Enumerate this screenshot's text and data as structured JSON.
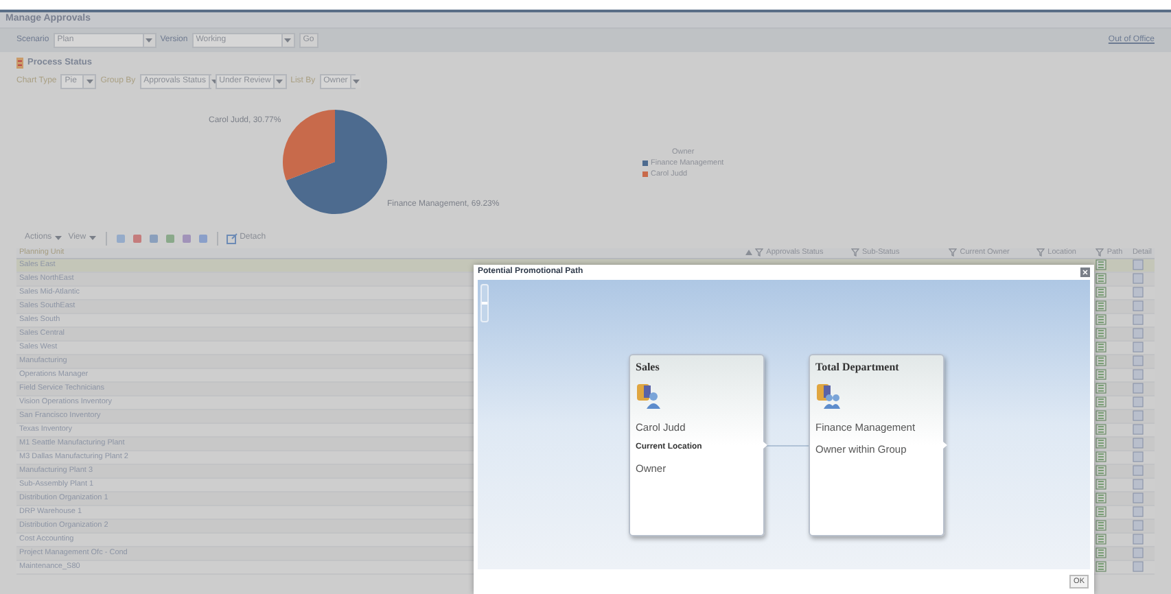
{
  "window": {
    "title": "Manage Approvals",
    "link": "Out of Office"
  },
  "filters": [
    {
      "label": "Scenario",
      "value": "Plan"
    },
    {
      "label": "Version",
      "value": "Working"
    }
  ],
  "go_button": "Go",
  "process_status": {
    "title": "Process Status",
    "controls": [
      {
        "label": "Chart Type",
        "value": "Pie"
      },
      {
        "label": "Group By",
        "value": "Approvals Status"
      },
      {
        "value": "Under Review"
      },
      {
        "label": "List By",
        "value": "Owner"
      }
    ],
    "chart_data": {
      "type": "pie",
      "categories": [
        "Finance Management",
        "Carol Judd"
      ],
      "series": [
        {
          "name": "Owner",
          "values": [
            69.23,
            30.77
          ]
        }
      ],
      "value_labels": [
        "Finance Management, 69.23%",
        "Carol Judd, 30.77%"
      ]
    },
    "legend": {
      "items": [
        {
          "color": "#4d6b8f"
        },
        {
          "color": "#c86a4b"
        }
      ]
    }
  },
  "toolbar": {
    "menus": [
      "Actions",
      "View"
    ],
    "detach": "Detach"
  },
  "table": {
    "columns": [
      {
        "label": "Planning Unit",
        "filter": false,
        "sorted": false
      },
      {
        "label": "Approvals Status",
        "filter": true,
        "sorted": true
      },
      {
        "label": "Sub-Status",
        "filter": true,
        "sorted": false
      },
      {
        "label": "Current Owner",
        "filter": true,
        "sorted": false
      },
      {
        "label": "Location",
        "filter": true,
        "sorted": false
      },
      {
        "label": "Path",
        "filter": true,
        "sorted": false
      },
      {
        "label": "Detail",
        "filter": false,
        "sorted": false
      }
    ],
    "rows": [
      {
        "planning_unit": "Sales East",
        "selected": true
      },
      {
        "planning_unit": "Sales NorthEast",
        "selected": false
      },
      {
        "planning_unit": "Sales Mid-Atlantic",
        "selected": false
      },
      {
        "planning_unit": "Sales SouthEast",
        "selected": false
      },
      {
        "planning_unit": "Sales South",
        "selected": false
      },
      {
        "planning_unit": "Sales Central",
        "selected": false
      },
      {
        "planning_unit": "Sales West",
        "selected": false
      },
      {
        "planning_unit": "Manufacturing",
        "selected": false
      },
      {
        "planning_unit": "Operations Manager",
        "selected": false
      },
      {
        "planning_unit": "Field Service Technicians",
        "selected": false
      },
      {
        "planning_unit": "Vision Operations Inventory",
        "selected": false
      },
      {
        "planning_unit": "San Francisco Inventory",
        "selected": false
      },
      {
        "planning_unit": "Texas Inventory",
        "selected": false
      },
      {
        "planning_unit": "M1 Seattle Manufacturing Plant",
        "selected": false
      },
      {
        "planning_unit": "M3 Dallas Manufacturing Plant 2",
        "selected": false
      },
      {
        "planning_unit": "Manufacturing Plant 3",
        "selected": false
      },
      {
        "planning_unit": "Sub-Assembly Plant 1",
        "selected": false
      },
      {
        "planning_unit": "Distribution Organization 1",
        "selected": false
      },
      {
        "planning_unit": "DRP Warehouse 1",
        "selected": false
      },
      {
        "planning_unit": "Distribution Organization 2",
        "selected": false
      },
      {
        "planning_unit": "Cost Accounting",
        "selected": false
      },
      {
        "planning_unit": "Project Management Ofc - Cond",
        "selected": false
      },
      {
        "planning_unit": "Maintenance_S80",
        "selected": false
      }
    ]
  },
  "modal": {
    "title": "Potential Promotional Path",
    "ok_button": "OK",
    "zoom": {
      "level": 0.5
    },
    "nodes": [
      {
        "title": "Sales",
        "kind": "user",
        "lines": [
          {
            "text": "Carol Judd",
            "bold": false
          },
          {
            "text": "Current Location",
            "bold": true
          },
          {
            "text": "Owner",
            "bold": false
          }
        ]
      },
      {
        "title": "Total Department",
        "kind": "group",
        "lines": [
          {
            "text": "Finance Management",
            "bold": false
          },
          {
            "text": "Owner within Group",
            "bold": false
          }
        ]
      }
    ]
  }
}
